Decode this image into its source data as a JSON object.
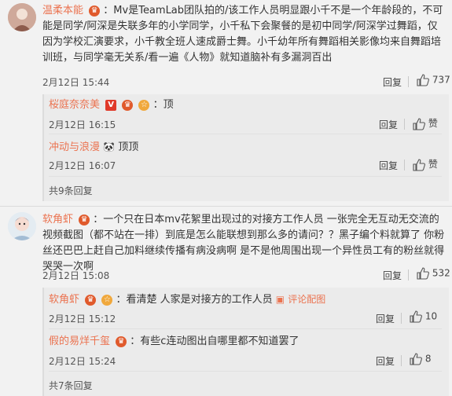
{
  "comment1": {
    "username": "温柔本能",
    "text": "：Mv是TeamLab团队拍的/该工作人员明显跟小千不是一个年龄段的，不可能是同学/阿深是失联多年的小学同学，小千私下会聚餐的是初中同学/阿深学过舞蹈，仅因为学校汇演要求，小千教全班人速成爵士舞。小千幼年所有舞蹈相关影像均来自舞蹈培训班，与同学毫无关系/看一遍《人物》就知道脑补有多漏洞百出",
    "date": "2月12日 15:44",
    "reply_label": "回复",
    "likes": "737"
  },
  "replies1": [
    {
      "username": "桜庭奈奈美",
      "text": "：顶",
      "date": "2月12日 16:15",
      "reply_label": "回复",
      "likes": "赞"
    },
    {
      "username": "冲动与浪漫",
      "text": "顶顶",
      "date": "2月12日 16:07",
      "reply_label": "回复",
      "likes": "赞"
    }
  ],
  "more1": "共9条回复",
  "comment2": {
    "username": "软角虾",
    "text": "：一个只在日本mv花絮里出现过的对接方工作人员 一张完全无互动无交流的视频截图（都不站在一排）到底是怎么能联想到那么多的请问？？黑子编个料就算了 你粉丝还巴巴上赶自己加料继续传播有病没病啊 是不是他周围出现一个异性员工有的粉丝就得哭哭一次啊",
    "date": "2月12日 15:08",
    "reply_label": "回复",
    "likes": "532"
  },
  "replies2": [
    {
      "username": "软角虾",
      "text": "：看清楚 人家是对接方的工作人员",
      "link": "评论配图",
      "date": "2月12日 15:12",
      "reply_label": "回复",
      "likes": "10"
    },
    {
      "username": "假的易烊千玺",
      "text": "：有些c连动图出自哪里都不知道罢了",
      "date": "2月12日 15:24",
      "reply_label": "回复",
      "likes": "8"
    }
  ],
  "more2": "共7条回复",
  "colors": {
    "username": "#eb7350",
    "background": "#f2f2f2"
  }
}
